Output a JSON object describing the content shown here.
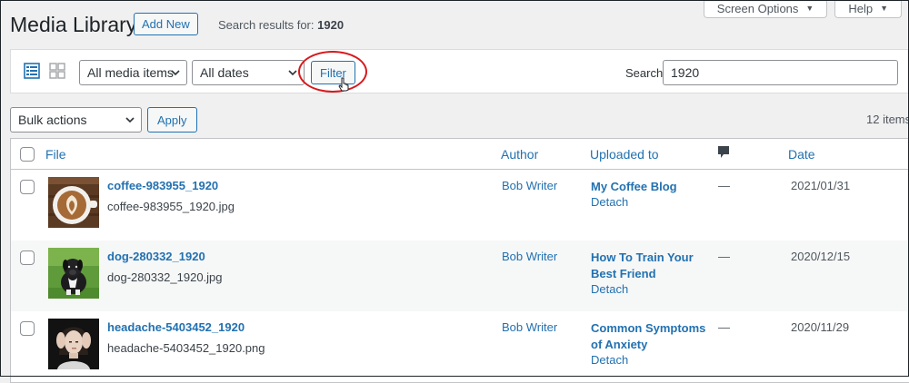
{
  "screen_meta": {
    "screen_options_label": "Screen Options",
    "help_label": "Help"
  },
  "header": {
    "title": "Media Library",
    "add_new_label": "Add New",
    "search_results_prefix": "Search results for:",
    "search_query": "1920"
  },
  "filters": {
    "media_type": "All media items",
    "dates": "All dates",
    "filter_label": "Filter",
    "search_label": "Search",
    "search_value": "1920"
  },
  "bulk": {
    "selected": "Bulk actions",
    "apply_label": "Apply",
    "items_count": "12 items"
  },
  "table": {
    "columns": {
      "file": "File",
      "author": "Author",
      "uploaded_to": "Uploaded to",
      "date": "Date"
    },
    "rows": [
      {
        "title": "coffee-983955_1920",
        "filename": "coffee-983955_1920.jpg",
        "author": "Bob Writer",
        "uploaded_to": "My Coffee Blog",
        "detach": "Detach",
        "comments": "—",
        "date": "2021/01/31",
        "thumb_icon": "coffee-thumbnail"
      },
      {
        "title": "dog-280332_1920",
        "filename": "dog-280332_1920.jpg",
        "author": "Bob Writer",
        "uploaded_to": "How To Train Your Best Friend",
        "detach": "Detach",
        "comments": "—",
        "date": "2020/12/15",
        "thumb_icon": "dog-thumbnail"
      },
      {
        "title": "headache-5403452_1920",
        "filename": "headache-5403452_1920.png",
        "author": "Bob Writer",
        "uploaded_to": "Common Symptoms of Anxiety",
        "detach": "Detach",
        "comments": "—",
        "date": "2020/11/29",
        "thumb_icon": "headache-thumbnail"
      }
    ]
  },
  "colors": {
    "accent": "#2271b1",
    "background": "#f0f0f1",
    "highlight_circle": "#d7191c"
  }
}
